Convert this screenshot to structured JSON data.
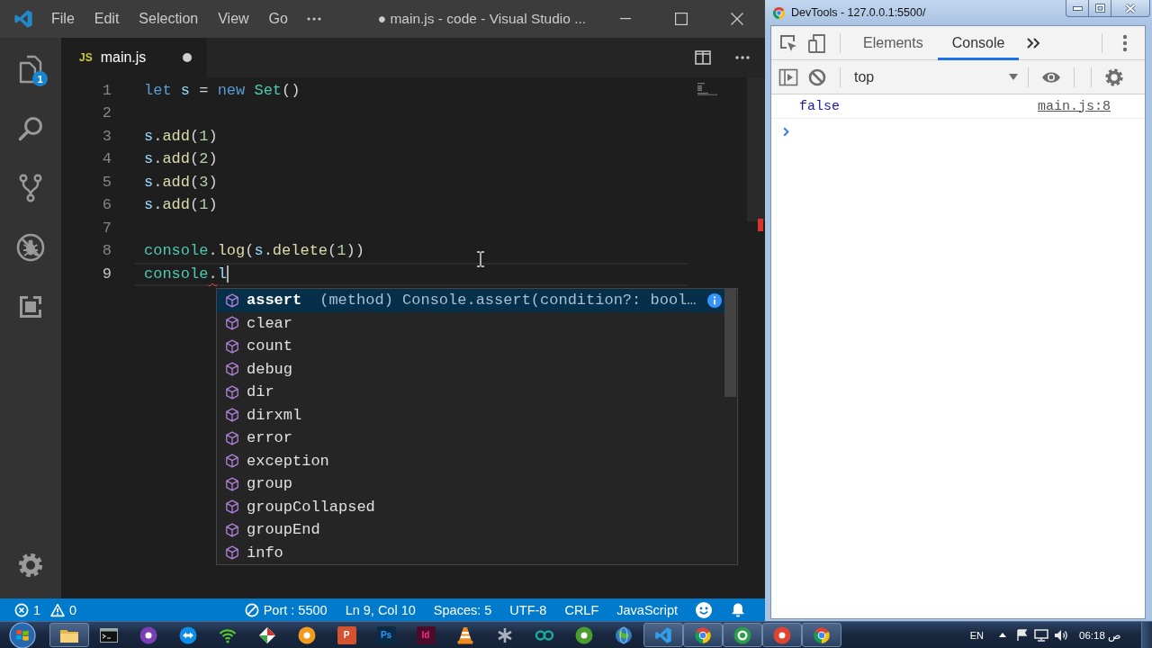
{
  "vscode": {
    "menu": [
      "File",
      "Edit",
      "Selection",
      "View",
      "Go"
    ],
    "title": "● main.js - code - Visual Studio ...",
    "activity_bar": [
      {
        "kind": "explorer",
        "badge": "1"
      },
      {
        "kind": "search"
      },
      {
        "kind": "source_control"
      },
      {
        "kind": "debug"
      },
      {
        "kind": "extensions"
      }
    ],
    "tab": {
      "file_badge": "JS",
      "label": "main.js",
      "modified": true,
      "selected": true
    },
    "lines": [
      {
        "number": "1",
        "current": false,
        "tokens": [
          {
            "text": "let",
            "kind": "keyword"
          },
          {
            "text": " s",
            "kind": "variable"
          },
          {
            "text": " = ",
            "kind": "plain"
          },
          {
            "text": "new",
            "kind": "keyword"
          },
          {
            "text": " Set",
            "kind": "class"
          },
          {
            "text": "()",
            "kind": "plain"
          }
        ]
      },
      {
        "number": "2",
        "current": false
      },
      {
        "number": "3",
        "current": false,
        "tokens": [
          {
            "text": "s",
            "kind": "variable"
          },
          {
            "text": ".",
            "kind": "plain"
          },
          {
            "text": "add",
            "kind": "function"
          },
          {
            "text": "(",
            "kind": "plain"
          },
          {
            "text": "1",
            "kind": "number"
          },
          {
            "text": ")",
            "kind": "plain"
          }
        ]
      },
      {
        "number": "4",
        "current": false,
        "tokens": [
          {
            "text": "s",
            "kind": "variable"
          },
          {
            "text": ".",
            "kind": "plain"
          },
          {
            "text": "add",
            "kind": "function"
          },
          {
            "text": "(",
            "kind": "plain"
          },
          {
            "text": "2",
            "kind": "number"
          },
          {
            "text": ")",
            "kind": "plain"
          }
        ]
      },
      {
        "number": "5",
        "current": false,
        "tokens": [
          {
            "text": "s",
            "kind": "variable"
          },
          {
            "text": ".",
            "kind": "plain"
          },
          {
            "text": "add",
            "kind": "function"
          },
          {
            "text": "(",
            "kind": "plain"
          },
          {
            "text": "3",
            "kind": "number"
          },
          {
            "text": ")",
            "kind": "plain"
          }
        ]
      },
      {
        "number": "6",
        "current": false,
        "tokens": [
          {
            "text": "s",
            "kind": "variable"
          },
          {
            "text": ".",
            "kind": "plain"
          },
          {
            "text": "add",
            "kind": "function"
          },
          {
            "text": "(",
            "kind": "plain"
          },
          {
            "text": "1",
            "kind": "number"
          },
          {
            "text": ")",
            "kind": "plain"
          }
        ]
      },
      {
        "number": "7",
        "current": false
      },
      {
        "number": "8",
        "current": false,
        "tokens": [
          {
            "text": "console",
            "kind": "class"
          },
          {
            "text": ".",
            "kind": "plain"
          },
          {
            "text": "log",
            "kind": "function"
          },
          {
            "text": "(",
            "kind": "plain"
          },
          {
            "text": "s",
            "kind": "variable"
          },
          {
            "text": ".",
            "kind": "plain"
          },
          {
            "text": "delete",
            "kind": "function"
          },
          {
            "text": "(",
            "kind": "plain"
          },
          {
            "text": "1",
            "kind": "number"
          },
          {
            "text": "))",
            "kind": "plain"
          }
        ]
      },
      {
        "number": "9",
        "current": true,
        "tokens": [
          {
            "text": "console",
            "kind": "class"
          },
          {
            "text": ".",
            "kind": "error"
          },
          {
            "text": "l",
            "kind": "variable"
          }
        ]
      }
    ],
    "suggestions": [
      {
        "label": "assert",
        "selected": true,
        "detail": "(method) Console.assert(condition?: bool…"
      },
      {
        "label": "clear",
        "selected": false
      },
      {
        "label": "count",
        "selected": false
      },
      {
        "label": "debug",
        "selected": false
      },
      {
        "label": "dir",
        "selected": false
      },
      {
        "label": "dirxml",
        "selected": false
      },
      {
        "label": "error",
        "selected": false
      },
      {
        "label": "exception",
        "selected": false
      },
      {
        "label": "group",
        "selected": false
      },
      {
        "label": "groupCollapsed",
        "selected": false
      },
      {
        "label": "groupEnd",
        "selected": false
      },
      {
        "label": "info",
        "selected": false
      }
    ],
    "status_bar": {
      "errors": "1",
      "warnings": "0",
      "items": [
        {
          "kind": "port",
          "text": "Port : 5500"
        },
        {
          "kind": "text",
          "text": "Ln 9, Col 10"
        },
        {
          "kind": "text",
          "text": "Spaces: 5"
        },
        {
          "kind": "text",
          "text": "UTF-8"
        },
        {
          "kind": "text",
          "text": "CRLF"
        },
        {
          "kind": "text",
          "text": "JavaScript"
        }
      ]
    }
  },
  "devtools": {
    "title": "DevTools - 127.0.0.1:5500/",
    "tabs": [
      {
        "label": "Elements",
        "selected": false
      },
      {
        "label": "Console",
        "selected": true
      }
    ],
    "context": "top",
    "messages": [
      {
        "text": "false",
        "source": "main.js:8"
      }
    ]
  },
  "taskbar": {
    "apps": [
      {
        "kind": "folder",
        "running": true
      },
      {
        "kind": "terminal",
        "running": false
      },
      {
        "kind": "disc",
        "color": "#7b3fb5",
        "running": false
      },
      {
        "kind": "arrows",
        "running": false
      },
      {
        "kind": "wifi",
        "running": false
      },
      {
        "kind": "app",
        "running": false
      },
      {
        "kind": "disc",
        "color": "#f29b1d",
        "running": false
      },
      {
        "kind": "tile",
        "label": "P",
        "color": "#d35230",
        "running": false
      },
      {
        "kind": "tile",
        "label": "Ps",
        "color": "#0b2a45",
        "running": false
      },
      {
        "kind": "tile",
        "label": "Id",
        "color": "#4b0c2a",
        "running": false
      },
      {
        "kind": "cone",
        "running": false
      },
      {
        "kind": "asterisk",
        "running": false
      },
      {
        "kind": "loop",
        "running": false
      },
      {
        "kind": "disc",
        "color": "#4a9e2f",
        "running": false
      },
      {
        "kind": "globe",
        "running": false
      },
      {
        "kind": "editor",
        "running": true
      },
      {
        "kind": "browser",
        "running": true
      },
      {
        "kind": "ring",
        "color": "#2a9d4a",
        "running": true
      },
      {
        "kind": "disc",
        "color": "#e0432f",
        "running": true
      },
      {
        "kind": "browser",
        "running": true
      }
    ],
    "language": "EN",
    "clock": "06:18 ص"
  }
}
